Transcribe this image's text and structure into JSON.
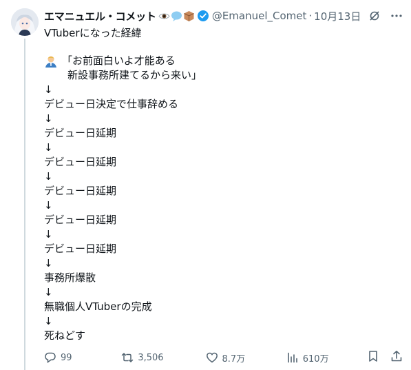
{
  "author": {
    "display_name": "エマニュエル・コメット",
    "handle": "@Emanuel_Comet",
    "separator": "·",
    "date": "10月13日",
    "verified": true,
    "name_emojis": [
      "eye-emoji-icon",
      "speech-bubble-emoji-icon",
      "package-emoji-icon"
    ]
  },
  "post": {
    "title": "VTuberになった経緯",
    "quote_lines": [
      "「お前面白いよ才能ある",
      "新設事務所建てるから来い」"
    ],
    "steps": [
      "↓",
      "デビュー日決定で仕事辞める",
      "↓",
      "デビュー日延期",
      "↓",
      "デビュー日延期",
      "↓",
      "デビュー日延期",
      "↓",
      "デビュー日延期",
      "↓",
      "デビュー日延期",
      "↓",
      "事務所爆散",
      "↓",
      "無職個人VTuberの完成",
      "↓",
      "死ねどす"
    ]
  },
  "stats": {
    "replies": "99",
    "reposts": "3,506",
    "likes": "8.7万",
    "views": "610万"
  },
  "colors": {
    "text": "#0f1419",
    "muted": "#536471",
    "verified": "#1d9bf0",
    "thread_line": "#cfd9de"
  }
}
